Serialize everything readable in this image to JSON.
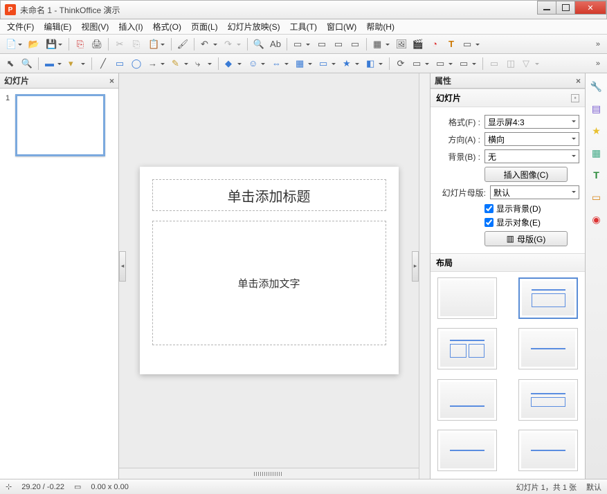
{
  "window": {
    "title": "未命名 1 - ThinkOffice 演示"
  },
  "menu": {
    "file": "文件(F)",
    "edit": "编辑(E)",
    "view": "视图(V)",
    "insert": "插入(I)",
    "format": "格式(O)",
    "page": "页面(L)",
    "slideshow": "幻灯片放映(S)",
    "tools": "工具(T)",
    "window": "窗口(W)",
    "help": "帮助(H)"
  },
  "panels": {
    "slides_title": "幻灯片",
    "properties_title": "属性",
    "slide_section": "幻灯片",
    "layout_section": "布局"
  },
  "thumb": {
    "num": "1"
  },
  "slide": {
    "title_placeholder": "单击添加标题",
    "body_placeholder": "单击添加文字"
  },
  "props": {
    "format_label": "格式(F) :",
    "format_value": "显示屏4:3",
    "orient_label": "方向(A) :",
    "orient_value": "横向",
    "bg_label": "背景(B) :",
    "bg_value": "无",
    "insert_image_btn": "插入图像(C)",
    "master_label": "幻灯片母版:",
    "master_value": "默认",
    "show_bg": "显示背景(D)",
    "show_obj": "显示对象(E)",
    "master_btn": "母版(G)"
  },
  "status": {
    "coords": "29.20 / -0.22",
    "size": "0.00 x 0.00",
    "slide_info": "幻灯片 1，共 1 张",
    "mode": "默认"
  },
  "toolbar_expand": "»"
}
